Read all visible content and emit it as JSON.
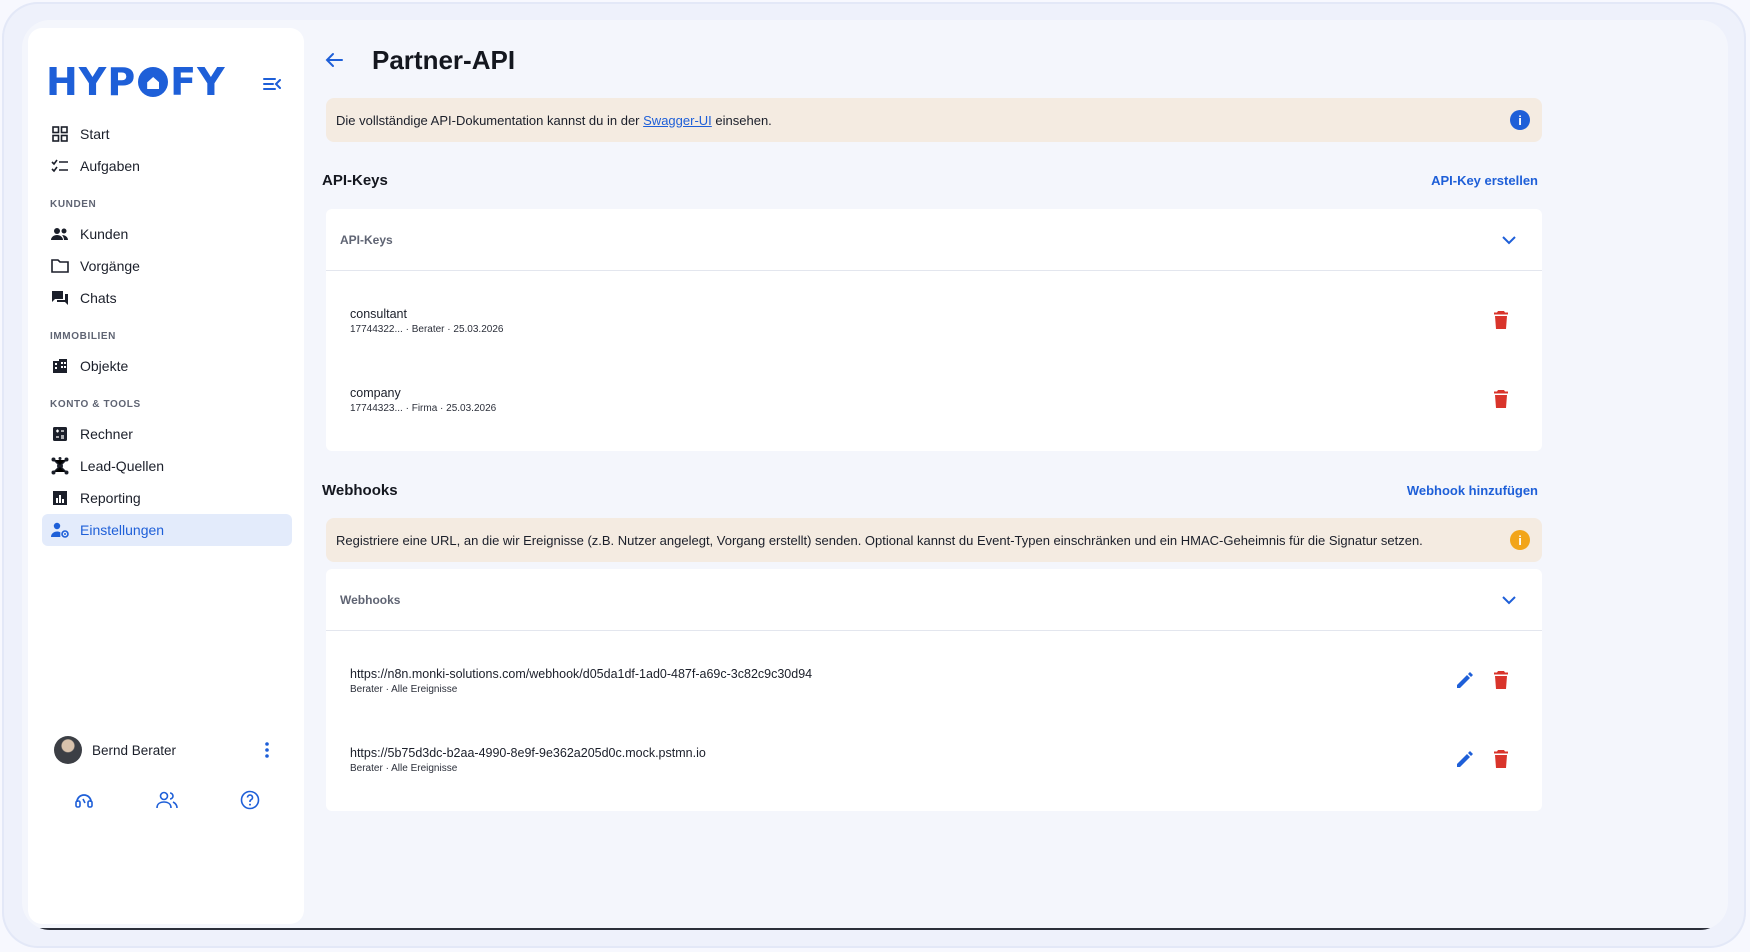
{
  "colors": {
    "accent": "#1e5fd8",
    "danger": "#d9342b",
    "warning": "#f2a51a",
    "banner_bg": "#f4ebe1"
  },
  "sidebar": {
    "logo": {
      "left": "HYP",
      "right": "FY"
    },
    "items_top": [
      {
        "label": "Start",
        "icon": "grid-icon"
      },
      {
        "label": "Aufgaben",
        "icon": "checklist-icon"
      }
    ],
    "sections": [
      {
        "title": "KUNDEN",
        "items": [
          {
            "label": "Kunden",
            "icon": "people-icon"
          },
          {
            "label": "Vorgänge",
            "icon": "folder-icon"
          },
          {
            "label": "Chats",
            "icon": "chat-icon"
          }
        ]
      },
      {
        "title": "IMMOBILIEN",
        "items": [
          {
            "label": "Objekte",
            "icon": "building-icon"
          }
        ]
      },
      {
        "title": "KONTO & TOOLS",
        "items": [
          {
            "label": "Rechner",
            "icon": "calculator-icon"
          },
          {
            "label": "Lead-Quellen",
            "icon": "hub-icon"
          },
          {
            "label": "Reporting",
            "icon": "chart-icon"
          },
          {
            "label": "Einstellungen",
            "icon": "user-gear-icon",
            "active": true
          }
        ]
      }
    ],
    "user": {
      "name": "Bernd Berater"
    }
  },
  "header": {
    "title": "Partner-API"
  },
  "api_banner": {
    "before": "Die vollständige API-Dokumentation kannst du in der ",
    "link": "Swagger-UI",
    "after": " einsehen."
  },
  "api_keys": {
    "title": "API-Keys",
    "action": "API-Key erstellen",
    "card_title": "API-Keys",
    "rows": [
      {
        "title": "consultant",
        "sub": "17744322... · Berater · 25.03.2026"
      },
      {
        "title": "company",
        "sub": "17744323... · Firma · 25.03.2026"
      }
    ]
  },
  "webhooks": {
    "title": "Webhooks",
    "action": "Webhook hinzufügen",
    "banner": "Registriere eine URL, an die wir Ereignisse (z.B. Nutzer angelegt, Vorgang erstellt) senden. Optional kannst du Event-Typen einschränken und ein HMAC-Geheimnis für die Signatur setzen.",
    "card_title": "Webhooks",
    "rows": [
      {
        "title": "https://n8n.monki-solutions.com/webhook/d05da1df-1ad0-487f-a69c-3c82c9c30d94",
        "sub": "Berater · Alle Ereignisse"
      },
      {
        "title": "https://5b75d3dc-b2aa-4990-8e9f-9e362a205d0c.mock.pstmn.io",
        "sub": "Berater · Alle Ereignisse"
      }
    ]
  }
}
